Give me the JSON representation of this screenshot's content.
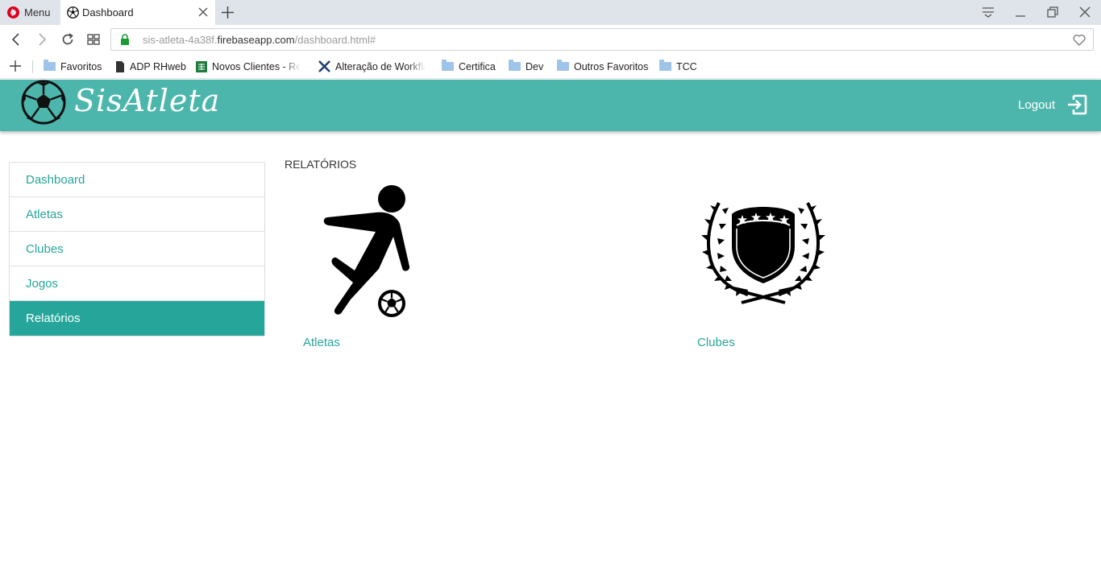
{
  "browser": {
    "menu_label": "Menu",
    "tab_title": "Dashboard",
    "url_prefix": "sis-atleta-4a38f.",
    "url_host": "firebaseapp.com",
    "url_path": "/dashboard.html#",
    "bookmarks": [
      {
        "label": "Favoritos",
        "icon": "folder-icon"
      },
      {
        "label": "ADP RHweb",
        "icon": "document-icon"
      },
      {
        "label": "Novos Clientes - Rec",
        "icon": "sheets-icon"
      },
      {
        "label": "Alteração de Workflo",
        "icon": "tools-icon"
      },
      {
        "label": "Certifica",
        "icon": "folder-icon"
      },
      {
        "label": "Dev",
        "icon": "folder-icon"
      },
      {
        "label": "Outros Favoritos",
        "icon": "folder-icon"
      },
      {
        "label": "TCC",
        "icon": "folder-icon"
      }
    ]
  },
  "app": {
    "brand": "SisAtleta",
    "logout_label": "Logout",
    "accent": "#4db6ac",
    "accent_dark": "#26a69a"
  },
  "sidebar": {
    "items": [
      {
        "label": "Dashboard",
        "active": false
      },
      {
        "label": "Atletas",
        "active": false
      },
      {
        "label": "Clubes",
        "active": false
      },
      {
        "label": "Jogos",
        "active": false
      },
      {
        "label": "Relatórios",
        "active": true
      }
    ]
  },
  "main": {
    "title": "RELATÓRIOS",
    "cards": [
      {
        "label": "Atletas",
        "icon": "soccer-player-icon"
      },
      {
        "label": "Clubes",
        "icon": "club-crest-icon"
      }
    ]
  }
}
